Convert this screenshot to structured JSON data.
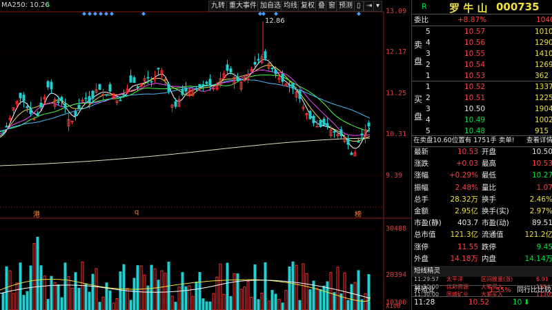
{
  "toolbar": {
    "ma_label": "MA250: 10.26",
    "buttons": [
      "九转",
      "重大事件",
      "加自选",
      "均线",
      "复权",
      "叠",
      "窗",
      "预测"
    ]
  },
  "chart": {
    "price_axis": [
      "13.09",
      "12.17",
      "11.25",
      "10.31",
      "9.39"
    ],
    "high_label": "12.86",
    "volume_axis": [
      "30488",
      "20394",
      "10300",
      "X100"
    ],
    "marks": [
      "港",
      "q",
      "榜"
    ]
  },
  "header": {
    "r_label": "R",
    "stock_name": "罗 牛 山",
    "stock_code": "000735"
  },
  "order_book": {
    "weibi_label": "委比",
    "weibi_value": "+8.87%",
    "weibi_right": "1040",
    "sell_label": [
      "卖",
      "盘"
    ],
    "buy_label": [
      "买",
      "盘"
    ],
    "sell": [
      {
        "n": "5",
        "price": "10.57",
        "vol": "1010"
      },
      {
        "n": "4",
        "price": "10.56",
        "vol": "1290"
      },
      {
        "n": "3",
        "price": "10.55",
        "vol": "1410"
      },
      {
        "n": "2",
        "price": "10.54",
        "vol": "1269"
      },
      {
        "n": "1",
        "price": "10.53",
        "vol": "362"
      }
    ],
    "buy": [
      {
        "n": "1",
        "price": "10.52",
        "vol": "1337"
      },
      {
        "n": "2",
        "price": "10.51",
        "vol": "1225"
      },
      {
        "n": "3",
        "price": "10.50",
        "vol": "1904"
      },
      {
        "n": "4",
        "price": "10.49",
        "vol": "1002"
      },
      {
        "n": "5",
        "price": "10.48",
        "vol": "915"
      }
    ],
    "notice": "在卖盘10.60位置有 1751手 卖单!",
    "notice_link": "查看详情"
  },
  "quote": [
    {
      "l1": "最新",
      "v1": "10.53",
      "l2": "开盘",
      "v2": "10.50"
    },
    {
      "l1": "涨跌",
      "v1": "+0.03",
      "l2": "最高",
      "v2": "10.53"
    },
    {
      "l1": "涨幅",
      "v1": "+0.29%",
      "l2": "最低",
      "v2": "10.27"
    },
    {
      "l1": "振幅",
      "v1": "2.48%",
      "l2": "量比",
      "v2": "1.07"
    },
    {
      "l1": "总手",
      "v1": "28.32万",
      "l2": "换手",
      "v2": "2.46%"
    },
    {
      "l1": "金额",
      "v1": "2.95亿",
      "l2": "换手(实)",
      "v2": "2.97%"
    },
    {
      "l1": "市盈(静)",
      "v1": "403.7",
      "l2": "市盈(动)",
      "v2": "89.51"
    },
    {
      "l1": "总市值",
      "v1": "121.3亿",
      "l2": "流通值",
      "v2": "121.2亿"
    },
    {
      "l1": "涨停",
      "v1": "11.55",
      "l2": "跌停",
      "v2": "9.45"
    },
    {
      "l1": "外盘",
      "v1": "14.18万",
      "l2": "内盘",
      "v2": "14.14万"
    }
  ],
  "short_line": {
    "title": "短线精灵",
    "items": [
      {
        "time": "11:29:57",
        "name": "太平洋",
        "event": "区间放量(涨)",
        "value": "6.91"
      },
      {
        "time": "11:30:00",
        "name": "优彩资源",
        "event": "大笔买入",
        "value": "1954"
      },
      {
        "time": "11:30:00",
        "name": "国城矿业",
        "event": "大笔买入",
        "value": "11305"
      }
    ]
  },
  "footer": {
    "sector_name": "养殖业",
    "sector_change": "1.55%",
    "compare_label": "同行比比较",
    "tick_time": "11:28",
    "tick_price": "10.52",
    "tick_vol": "10"
  }
}
